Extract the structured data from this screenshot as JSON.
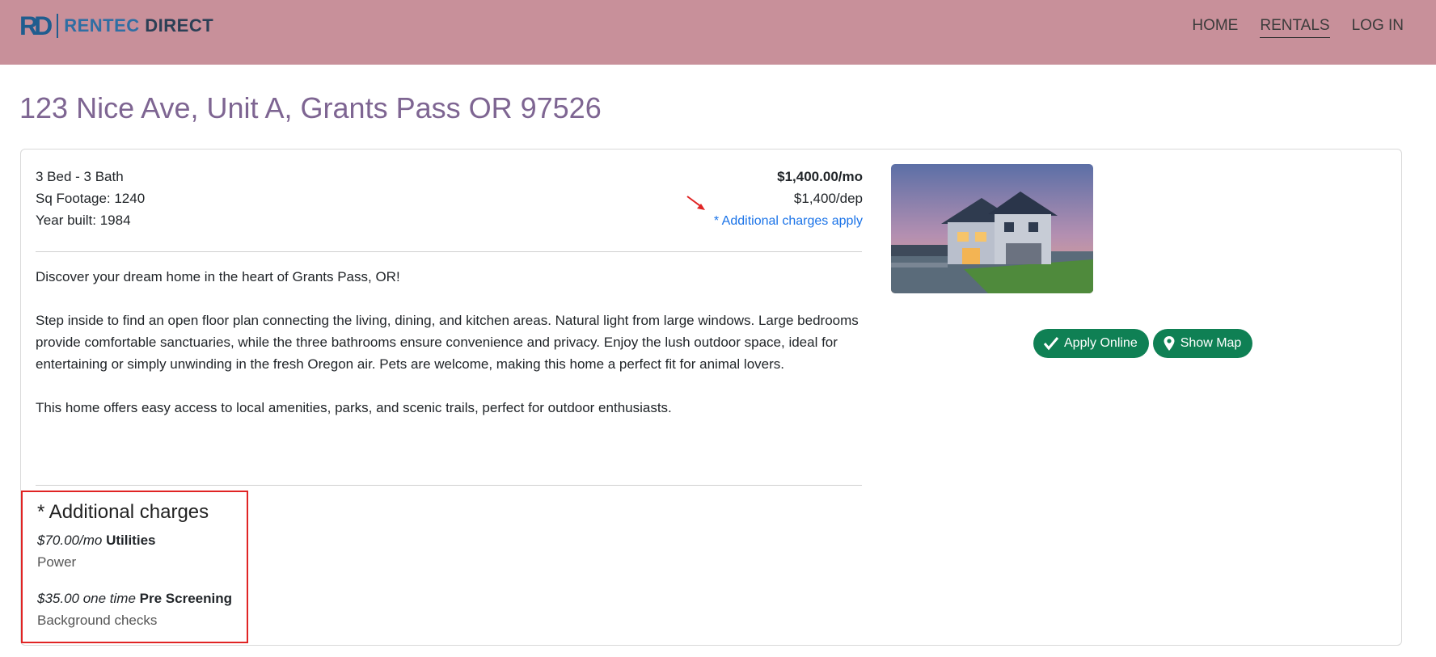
{
  "brand": {
    "mark": "RD",
    "name_part1": "RENTEC",
    "name_part2": "DIRECT"
  },
  "nav": {
    "home": "HOME",
    "rentals": "RENTALS",
    "login": "LOG IN"
  },
  "listing": {
    "title": "123 Nice Ave, Unit A, Grants Pass OR 97526",
    "beds_baths": "3 Bed - 3 Bath",
    "sqft": "Sq Footage: 1240",
    "year_built": "Year built: 1984",
    "rent": "$1,400.00/mo",
    "deposit": "$1,400/dep",
    "additional_link": "* Additional charges apply",
    "description": [
      "Discover your dream home in the heart of Grants Pass, OR!",
      "Step inside to find an open floor plan connecting the living, dining, and kitchen areas. Natural light from large windows. Large bedrooms provide comfortable sanctuaries, while the three bathrooms ensure convenience and privacy. Enjoy the lush outdoor space, ideal for entertaining or simply unwinding in the fresh Oregon air. Pets are welcome, making this home a perfect fit for animal lovers.",
      "This home offers easy access to local amenities, parks, and scenic trails, perfect for outdoor enthusiasts."
    ]
  },
  "actions": {
    "apply": "Apply Online",
    "map": "Show Map"
  },
  "charges": {
    "title": "* Additional charges",
    "items": [
      {
        "amount": "$70.00/mo",
        "name": "Utilities",
        "desc": "Power"
      },
      {
        "amount": "$35.00 one time",
        "name": "Pre Screening",
        "desc": "Background checks"
      }
    ]
  },
  "colors": {
    "header_bg": "#c8909a",
    "title": "#7e6592",
    "link": "#1a73e8",
    "button": "#0f8054",
    "highlight_border": "#e02424",
    "annotation_arrow": "#e02424"
  },
  "icons": [
    "check-icon",
    "map-pin-icon",
    "annotation-arrow-icon"
  ]
}
